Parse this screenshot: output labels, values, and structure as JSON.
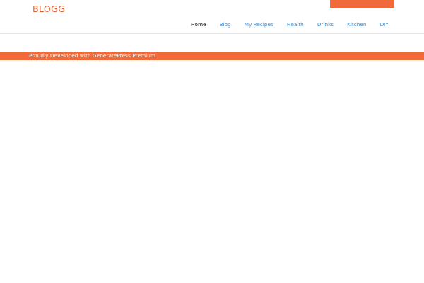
{
  "colors": {
    "accent": "#f06a3a",
    "logo": "#e0622f",
    "link": "#3d86c6",
    "active_link": "#111111",
    "divider": "#e6e6e6",
    "background": "#ffffff"
  },
  "header": {
    "logo_text": "BLOGG"
  },
  "nav": {
    "items": [
      {
        "label": "Home",
        "active": true
      },
      {
        "label": "Blog",
        "active": false
      },
      {
        "label": "My Recipes",
        "active": false
      },
      {
        "label": "Health",
        "active": false
      },
      {
        "label": "Drinks",
        "active": false
      },
      {
        "label": "Kitchen",
        "active": false
      },
      {
        "label": "DIY",
        "active": false
      }
    ]
  },
  "footer": {
    "credit_text": "Proudly Developed with GeneratePress Premium"
  }
}
